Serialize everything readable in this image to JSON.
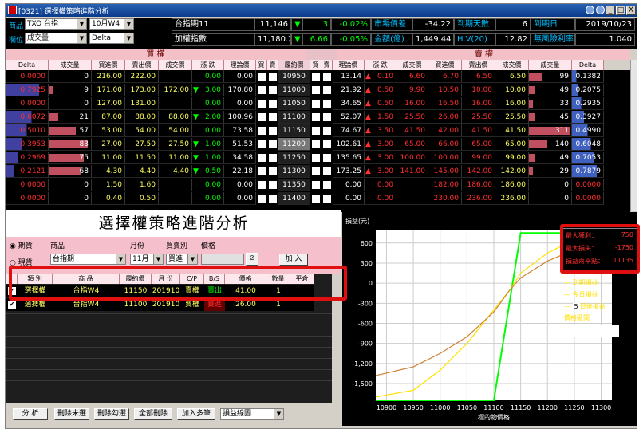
{
  "window": {
    "title": "[0321] 選擇權策略進階分析",
    "title_icon": "app-icon",
    "controls": [
      "⊕",
      "?",
      "_",
      "□",
      "X"
    ]
  },
  "header": {
    "product_label": "商品",
    "product_code": "TXO",
    "product_name": "台指",
    "month": "10月W4",
    "field_label": "欄位",
    "field1": "成交量",
    "field2": "Delta",
    "rows": [
      {
        "name": "台指期11",
        "price": "11,146",
        "arrow": "▼",
        "change": "3",
        "pct": "-0.02%",
        "k1": "市場價差",
        "v1": "-34.22",
        "k2": "到期天數",
        "v2": "6",
        "k3": "到期日",
        "v3": "2019/10/23"
      },
      {
        "name": "加權指數",
        "price": "11,180.22",
        "arrow": "▼",
        "change": "6.66",
        "pct": "-0.05%",
        "k1": "金額(億)",
        "v1": "1,449.44",
        "k2": "H.V(20)",
        "v2": "12.82",
        "k3": "無風險利率",
        "v3": "1.040"
      }
    ]
  },
  "sections": {
    "call": "買 權",
    "put": "賣 權"
  },
  "columns": {
    "call": [
      "Delta",
      "成交量",
      "買進價",
      "賣出價",
      "成交價",
      "漲 跌",
      "理論價",
      "買",
      "賣"
    ],
    "strike": "履約價",
    "put": [
      "買",
      "賣",
      "理論價",
      "漲 跌",
      "成交價",
      "買進價",
      "賣出價",
      "成交價",
      "成交量",
      "Delta"
    ]
  },
  "chain": [
    {
      "cd": "0.0000",
      "cv": "0",
      "cbid": "216.00",
      "cask": "222.00",
      "clast": "",
      "cch": "0.00",
      "carr": "",
      "cth": "0.00",
      "k": "10950",
      "pth": "13.14",
      "parr": "▲",
      "pch": "0.10",
      "plast": "6.60",
      "pbid": "6.70",
      "pask": "6.50",
      "pv": "99",
      "pd": "0.1382"
    },
    {
      "cd": "0.7925",
      "cv": "9",
      "cbid": "171.00",
      "cask": "173.00",
      "clast": "172.00",
      "cch": "3.00",
      "carr": "▼",
      "cth": "170.80",
      "k": "11000",
      "pth": "21.92",
      "parr": "▲",
      "pch": "0.50",
      "plast": "9.90",
      "pbid": "10.50",
      "pask": "10.00",
      "pv": "49",
      "pd": "0.2075"
    },
    {
      "cd": "0.0000",
      "cv": "0",
      "cbid": "127.00",
      "cask": "131.00",
      "clast": "",
      "cch": "0.00",
      "carr": "",
      "cth": "0.00",
      "k": "11050",
      "pth": "34.65",
      "parr": "▲",
      "pch": "0.50",
      "plast": "16.00",
      "pbid": "16.50",
      "pask": "16.00",
      "pv": "33",
      "pd": "0.2935"
    },
    {
      "cd": "0.6072",
      "cv": "21",
      "cbid": "87.00",
      "cask": "88.00",
      "clast": "88.00",
      "cch": "2.00",
      "carr": "▼",
      "cth": "100.96",
      "k": "11100",
      "pth": "52.07",
      "parr": "▲",
      "pch": "1.50",
      "plast": "25.50",
      "pbid": "26.00",
      "pask": "25.50",
      "pv": "45",
      "pd": "0.3927"
    },
    {
      "cd": "0.5010",
      "cv": "57",
      "cbid": "53.00",
      "cask": "54.00",
      "clast": "54.00",
      "cch": "0.00",
      "carr": "",
      "cth": "73.58",
      "k": "11150",
      "pth": "74.67",
      "parr": "▲",
      "pch": "3.50",
      "plast": "41.50",
      "pbid": "42.00",
      "pask": "41.50",
      "pv": "311",
      "pd": "0.4990"
    },
    {
      "cd": "0.3953",
      "cv": "83",
      "cbid": "27.00",
      "cask": "27.50",
      "clast": "27.50",
      "cch": "1.00",
      "carr": "▼",
      "cth": "51.53",
      "k": "11200",
      "pth": "102.61",
      "parr": "▲",
      "pch": "3.00",
      "plast": "65.00",
      "pbid": "66.00",
      "pask": "65.00",
      "pv": "140",
      "pd": "0.6048"
    },
    {
      "cd": "0.2969",
      "cv": "75",
      "cbid": "11.00",
      "cask": "11.50",
      "clast": "11.00",
      "cch": "1.00",
      "carr": "▼",
      "cth": "34.58",
      "k": "11250",
      "pth": "135.65",
      "parr": "▲",
      "pch": "3.00",
      "plast": "100.00",
      "pbid": "100.00",
      "pask": "99.00",
      "pv": "49",
      "pd": "0.7053"
    },
    {
      "cd": "0.2121",
      "cv": "68",
      "cbid": "4.30",
      "cask": "4.40",
      "clast": "4.40",
      "cch": "0.50",
      "carr": "▼",
      "cth": "22.18",
      "k": "11300",
      "pth": "173.25",
      "parr": "▲",
      "pch": "3.00",
      "plast": "141.00",
      "pbid": "145.00",
      "pask": "142.00",
      "pv": "29",
      "pd": "0.7879"
    },
    {
      "cd": "0.0000",
      "cv": "0",
      "cbid": "1.50",
      "cask": "1.60",
      "clast": "",
      "cch": "0.00",
      "carr": "",
      "cth": "0.00",
      "k": "11350",
      "pth": "0.00",
      "parr": "",
      "pch": "0.00",
      "plast": "",
      "pbid": "182.00",
      "pask": "186.00",
      "pv": "0",
      "pd": "0.0000"
    },
    {
      "cd": "0.0000",
      "cv": "0",
      "cbid": "0.40",
      "cask": "0.50",
      "clast": "",
      "cch": "0.00",
      "carr": "",
      "cth": "0.00",
      "k": "11400",
      "pth": "0.00",
      "parr": "",
      "pch": "0.00",
      "plast": "",
      "pbid": "230.00",
      "pask": "236.00",
      "pv": "0",
      "pd": "0.0000"
    }
  ],
  "strategy": {
    "title": "選擇權策略進階分析",
    "radio1": "期貨",
    "radio2": "現貨",
    "form_labels": [
      "商品",
      "月份",
      "買賣別",
      "價格"
    ],
    "product": "台指期",
    "month": "11月",
    "side": "買進",
    "price": "",
    "add_label": "加 入",
    "table_headers": [
      "類 別",
      "商 品",
      "履約價",
      "月 份",
      "C/P",
      "B/S",
      "價格",
      "數量",
      "平倉"
    ],
    "rows": [
      {
        "type": "選擇權",
        "product": "台指W4",
        "strike": "11150",
        "month": "201910",
        "cp": "賣權",
        "bs": "賣出",
        "price": "41.00",
        "qty": "1",
        "close": ""
      },
      {
        "type": "選擇權",
        "product": "台指W4",
        "strike": "11100",
        "month": "201910",
        "cp": "賣權",
        "bs": "買進",
        "price": "26.00",
        "qty": "1",
        "close": ""
      }
    ],
    "buttons": [
      "分 析",
      "刪除未選",
      "刪除勾選",
      "全部刪除",
      "加入多筆"
    ],
    "line_select": "損益線圖"
  },
  "pl_info": {
    "k1": "最大獲利：",
    "v1": "750",
    "k2": "最大損失：",
    "v2": "-1750",
    "k3": "損益兩平點：",
    "v3": "11135"
  },
  "legend": {
    "l1": "到期損益",
    "l2": "今日損益",
    "days": "5",
    "l3": "日後損益",
    "l4": "價格區間",
    "dash": "~"
  },
  "colors": {
    "expiry": "#00ff00",
    "today": "#ffe000",
    "later": "#d08030",
    "accent_red": "#e01010"
  },
  "chart_data": {
    "type": "line",
    "ylabel": "損益(元)",
    "xlabel": "標的物價格",
    "x_ticks": [
      "10900",
      "10950",
      "11000",
      "11050",
      "11100",
      "11150",
      "11200",
      "11250",
      "11300"
    ],
    "y_ticks": [
      "600",
      "300",
      "0",
      "-300",
      "-600",
      "-900",
      "-1,200",
      "-1,500"
    ],
    "xlim": [
      10880,
      11320
    ],
    "ylim": [
      -1750,
      800
    ],
    "series": [
      {
        "name": "到期損益",
        "x": [
          10880,
          11100,
          11150,
          11320
        ],
        "y": [
          -1750,
          -1750,
          750,
          750
        ]
      },
      {
        "name": "今日損益",
        "x": [
          10880,
          10950,
          11000,
          11050,
          11100,
          11130,
          11150,
          11200,
          11250,
          11320
        ],
        "y": [
          -1700,
          -1600,
          -1300,
          -900,
          -400,
          -100,
          150,
          450,
          650,
          760
        ]
      },
      {
        "name": "日後損益",
        "x": [
          10880,
          10950,
          11000,
          11050,
          11100,
          11130,
          11150,
          11200,
          11250,
          11320
        ],
        "y": [
          -1380,
          -1250,
          -1050,
          -800,
          -430,
          -100,
          80,
          330,
          500,
          620
        ]
      }
    ]
  }
}
